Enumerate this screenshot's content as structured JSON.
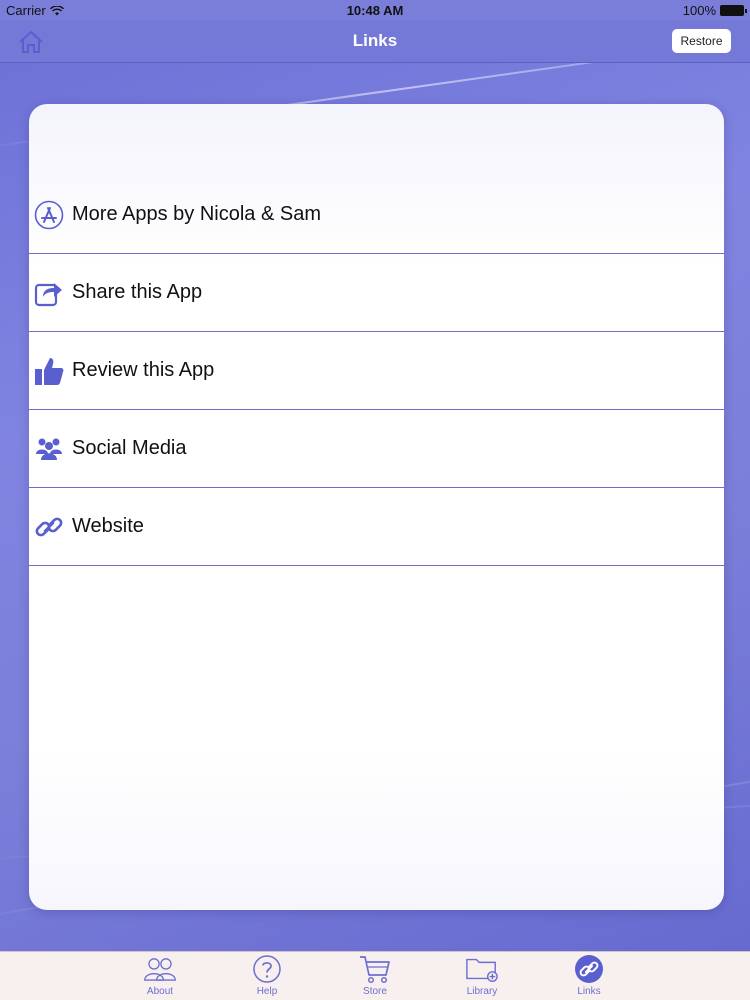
{
  "status_bar": {
    "carrier": "Carrier",
    "time": "10:48 AM",
    "battery": "100%"
  },
  "nav": {
    "title": "Links",
    "restore_label": "Restore"
  },
  "list": {
    "items": [
      {
        "label": "More Apps by Nicola & Sam",
        "icon": "app-store-icon"
      },
      {
        "label": "Share this App",
        "icon": "share-icon"
      },
      {
        "label": "Review this App",
        "icon": "thumbs-up-icon"
      },
      {
        "label": "Social Media",
        "icon": "people-icon"
      },
      {
        "label": "Website",
        "icon": "link-icon"
      }
    ]
  },
  "tab_bar": {
    "tabs": [
      {
        "label": "About",
        "icon": "people-outline-icon"
      },
      {
        "label": "Help",
        "icon": "question-icon"
      },
      {
        "label": "Store",
        "icon": "cart-icon"
      },
      {
        "label": "Library",
        "icon": "folder-add-icon"
      },
      {
        "label": "Links",
        "icon": "link-circle-icon",
        "selected": true
      }
    ]
  },
  "colors": {
    "accent": "#5a5fcf",
    "nav": "#7478d6",
    "tab_label": "#6b6fd0"
  }
}
